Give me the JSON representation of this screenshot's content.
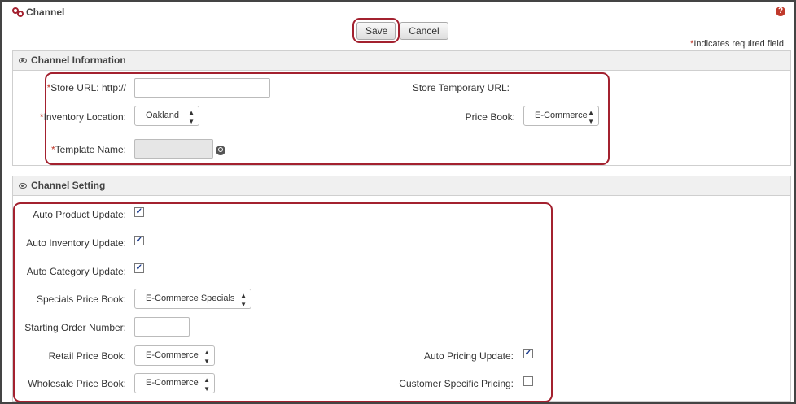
{
  "header": {
    "title": "Channel",
    "help_icon": "?"
  },
  "toolbar": {
    "save_label": "Save",
    "cancel_label": "Cancel"
  },
  "required_note": {
    "mark": "*",
    "text": "Indicates required field"
  },
  "channel_information": {
    "heading": "Channel Information",
    "store_url_label": "Store URL: http://",
    "store_url_value": "",
    "temporary_url_label": "Store Temporary URL:",
    "inventory_location_label": "Inventory Location:",
    "inventory_location_value": "Oakland",
    "price_book_label": "Price Book:",
    "price_book_value": "E-Commerce",
    "template_name_label": "Template Name:",
    "template_name_value": ""
  },
  "channel_setting": {
    "heading": "Channel Setting",
    "auto_product_update_label": "Auto Product Update:",
    "auto_product_update_checked": true,
    "auto_inventory_update_label": "Auto Inventory Update:",
    "auto_inventory_update_checked": true,
    "auto_category_update_label": "Auto Category Update:",
    "auto_category_update_checked": true,
    "specials_price_book_label": "Specials Price Book:",
    "specials_price_book_value": "E-Commerce Specials",
    "starting_order_number_label": "Starting Order Number:",
    "starting_order_number_value": "",
    "retail_price_book_label": "Retail Price Book:",
    "retail_price_book_value": "E-Commerce",
    "auto_pricing_update_label": "Auto Pricing Update:",
    "auto_pricing_update_checked": true,
    "wholesale_price_book_label": "Wholesale Price Book:",
    "wholesale_price_book_value": "E-Commerce",
    "customer_specific_pricing_label": "Customer Specific Pricing:",
    "customer_specific_pricing_checked": false
  },
  "colors": {
    "highlight": "#a3212f",
    "required": "#c0392b",
    "checkbox": "#1a3a8c"
  }
}
